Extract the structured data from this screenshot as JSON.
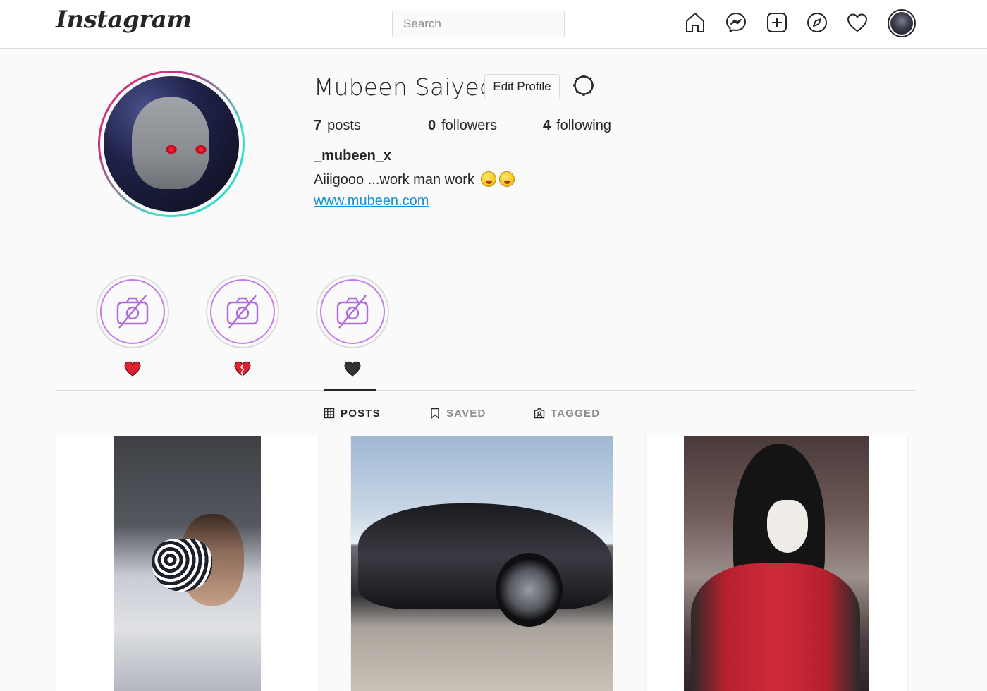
{
  "header": {
    "logo": "Instagram",
    "search_placeholder": "Search",
    "nav_icons": [
      "home-icon",
      "messenger-icon",
      "new-post-icon",
      "explore-icon",
      "activity-heart-icon",
      "profile-avatar"
    ]
  },
  "profile": {
    "display_name": "Mubeen Saiyed",
    "edit_button": "Edit Profile",
    "stats": {
      "posts": {
        "count": "7",
        "label": "posts"
      },
      "followers": {
        "count": "0",
        "label": "followers"
      },
      "following": {
        "count": "4",
        "label": "following"
      }
    },
    "handle": "_mubeen_x",
    "bio": "Aiiigooo ...work man work",
    "bio_emojis": [
      "zany-face-emoji",
      "zany-face-emoji"
    ],
    "website": "www.mubeen.com"
  },
  "highlights": [
    {
      "icon": "no-camera-icon",
      "label_icon": "red-heart-icon",
      "color": "#e0202e"
    },
    {
      "icon": "no-camera-icon",
      "label_icon": "broken-heart-icon",
      "color": "#e0202e"
    },
    {
      "icon": "no-camera-icon",
      "label_icon": "black-heart-icon",
      "color": "#333333"
    }
  ],
  "tabs": [
    {
      "label": "POSTS",
      "icon": "grid-icon",
      "active": true
    },
    {
      "label": "SAVED",
      "icon": "bookmark-icon",
      "active": false
    },
    {
      "label": "TAGGED",
      "icon": "tagged-icon",
      "active": false
    }
  ],
  "posts": [
    {
      "description": "person-in-car-with-mask"
    },
    {
      "description": "black-sports-car"
    },
    {
      "description": "anime-character-red-armor"
    }
  ],
  "colors": {
    "background": "#fafafa",
    "border": "#dbdbdb",
    "text": "#262626",
    "muted": "#8e8e8e",
    "link": "#1a8fd6"
  }
}
